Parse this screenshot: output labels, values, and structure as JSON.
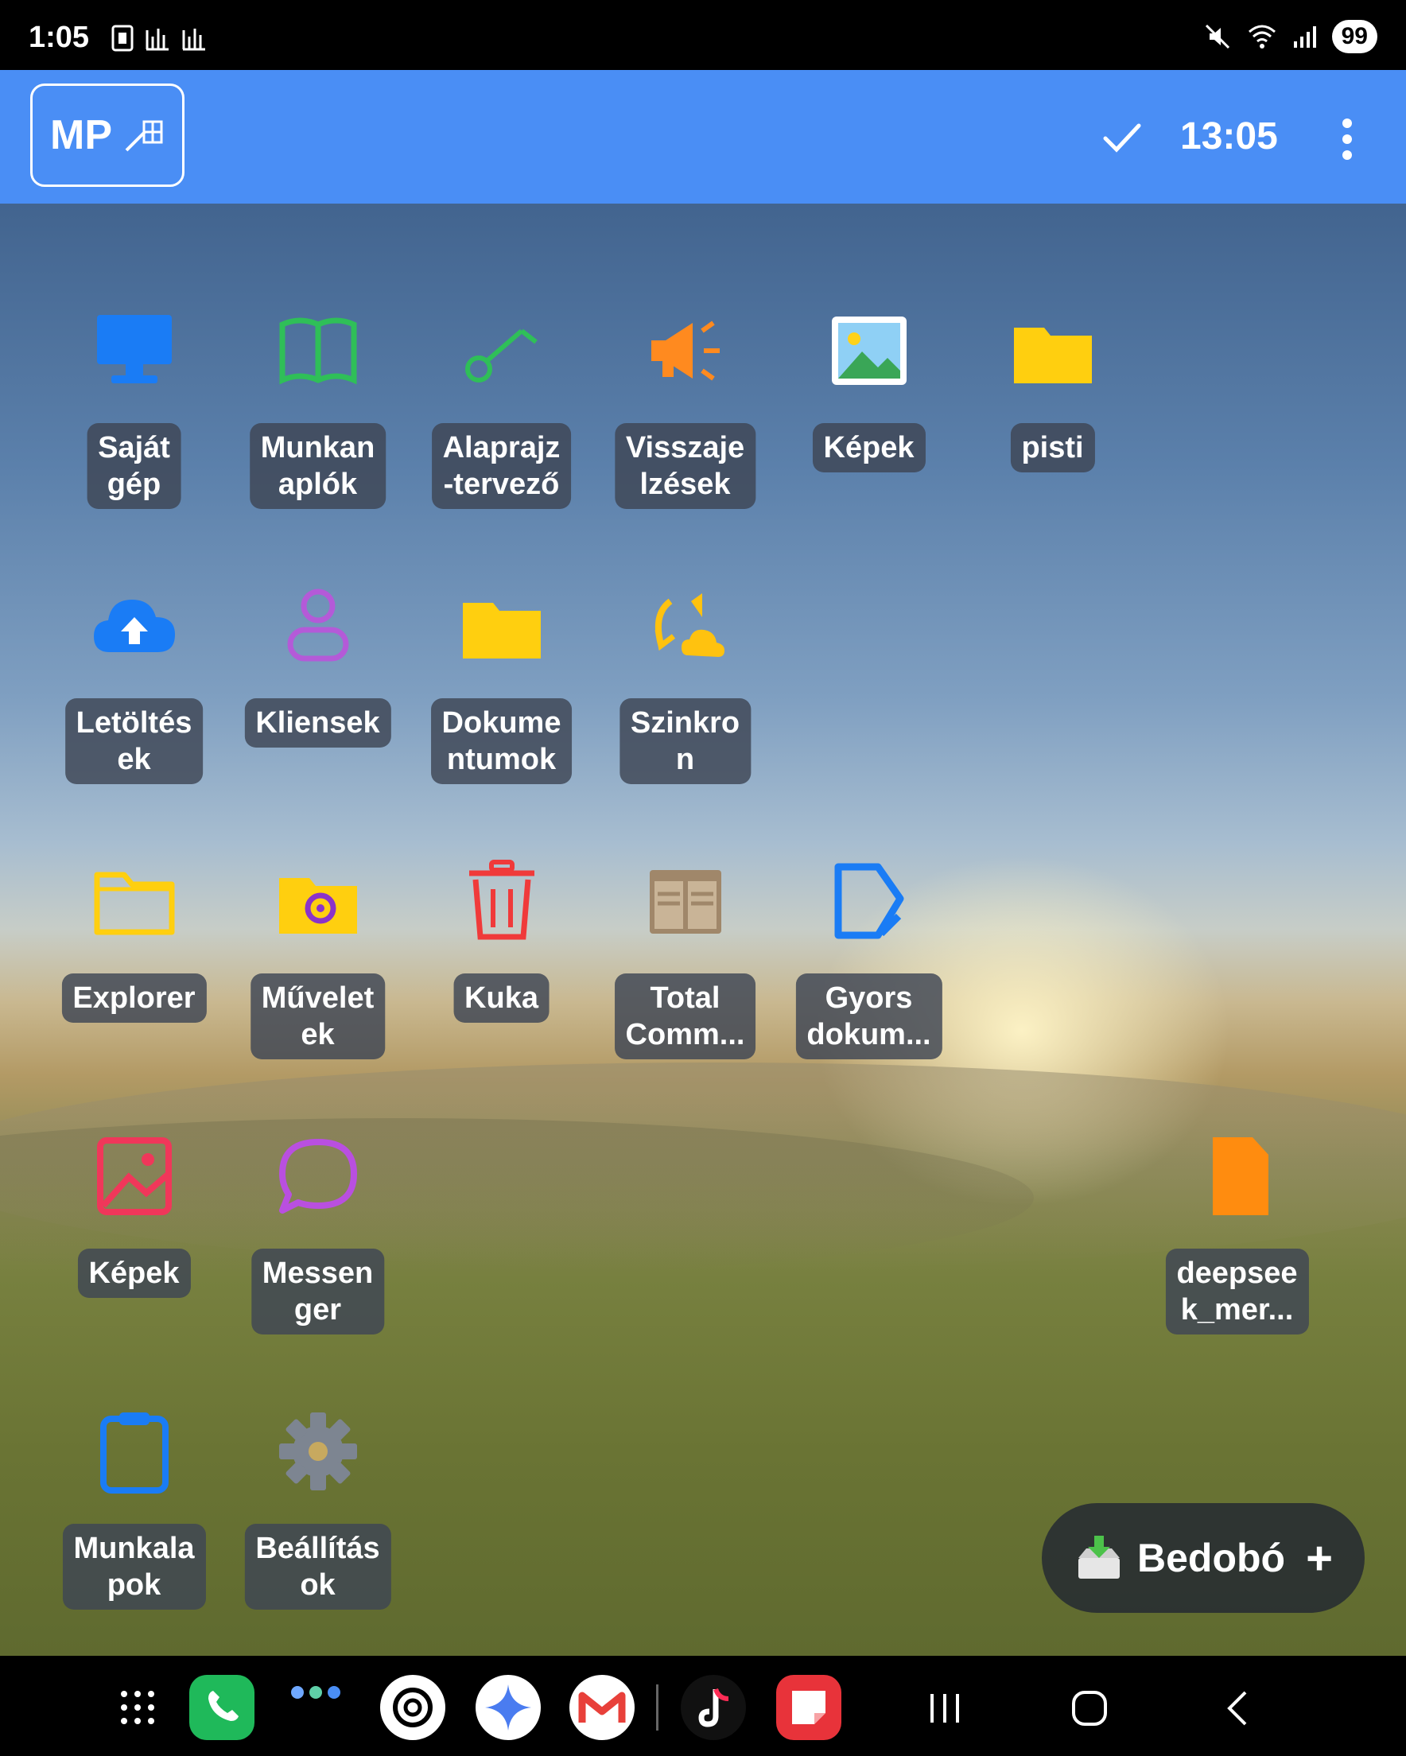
{
  "status_bar": {
    "time": "1:05",
    "battery": "99"
  },
  "header": {
    "mp_label": "MP",
    "time": "13:05"
  },
  "desktop": {
    "items": [
      {
        "label": "Saját\ngép",
        "icon": "monitor-icon"
      },
      {
        "label": "Munkan\naplók",
        "icon": "book-icon"
      },
      {
        "label": "Alaprajz\n-tervező",
        "icon": "key-icon"
      },
      {
        "label": "Visszaje\nlzések",
        "icon": "megaphone-icon"
      },
      {
        "label": "Képek",
        "icon": "image-icon"
      },
      {
        "label": "pisti",
        "icon": "folder-icon"
      },
      {
        "label": "Letöltés\nek",
        "icon": "cloud-upload-icon"
      },
      {
        "label": "Kliensek",
        "icon": "person-icon"
      },
      {
        "label": "Dokume\nntumok",
        "icon": "folder-icon"
      },
      {
        "label": "Szinkro\nn",
        "icon": "sync-icon"
      },
      {
        "label": "Explorer",
        "icon": "folder-outline-icon"
      },
      {
        "label": "Művelet\nek",
        "icon": "folder-gear-icon"
      },
      {
        "label": "Kuka",
        "icon": "trash-icon"
      },
      {
        "label": "Total\nComm...",
        "icon": "total-commander-icon"
      },
      {
        "label": "Gyors\ndokum...",
        "icon": "document-icon"
      },
      {
        "label": "Képek",
        "icon": "image-outline-icon"
      },
      {
        "label": "Messen\nger",
        "icon": "chat-icon"
      },
      {
        "label": "deepsee\nk_mer...",
        "icon": "file-icon"
      },
      {
        "label": "Munkala\npok",
        "icon": "clipboard-icon"
      },
      {
        "label": "Beállítás\nok",
        "icon": "gear-icon"
      }
    ]
  },
  "drop_button": {
    "label": "Bedobó",
    "plus": "+"
  },
  "colors": {
    "header_blue": "#4a8ef5",
    "label_bg": "#3e4654"
  }
}
